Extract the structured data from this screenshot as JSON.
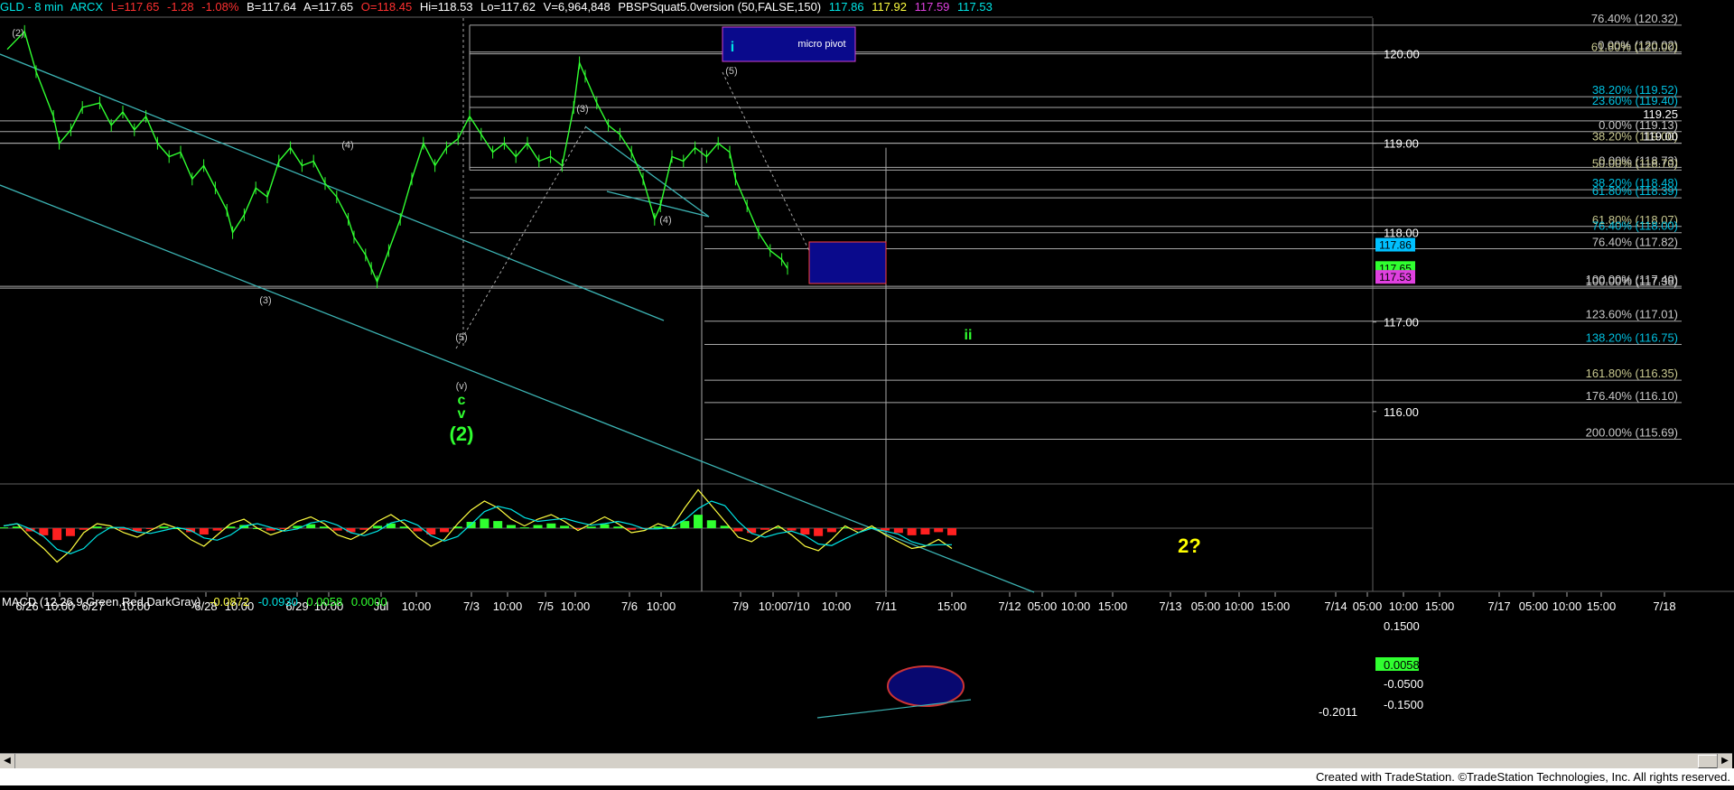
{
  "header": {
    "symbol": "GLD - 8 min",
    "exchange": "ARCX",
    "last": "L=117.65",
    "change": "-1.28",
    "pct": "-1.08%",
    "bid": "B=117.64",
    "ask": "A=117.65",
    "open": "O=118.45",
    "high": "Hi=118.53",
    "low": "Lo=117.62",
    "volume": "V=6,964,848",
    "study": "PBSPSquat5.0version (50,FALSE,150)",
    "v1": "117.86",
    "v2": "117.92",
    "v3": "117.59",
    "v4": "117.53",
    "colors": {
      "cyan": "#00e5e5",
      "yellow": "#ffff40",
      "magenta": "#e040e0",
      "neg": "#ff3030",
      "green": "#30ff30"
    }
  },
  "macd_header": {
    "title": "MACD (12,26,9,Green,Red,DarkGray)",
    "v1": "-0.0872",
    "v2": "-0.0930",
    "v3": "0.0058",
    "v4": "0.0000"
  },
  "footer": {
    "text": "Created with TradeStation. ©TradeStation Technologies, Inc. All rights reserved."
  },
  "chart_data": {
    "type": "candlestick",
    "symbol": "GLD",
    "interval": "8 min",
    "price_axis": {
      "ylim": [
        115.2,
        120.4
      ],
      "ticks": [
        "120.00",
        "119.00",
        "118.00",
        "117.00",
        "116.00"
      ]
    },
    "time_axis": {
      "labels": [
        "6/26",
        "10:00",
        "6/27",
        "10:00",
        "6/28",
        "10:00",
        "6/29",
        "10:00",
        "Jul",
        "10:00",
        "7/3",
        "10:00",
        "7/5",
        "10:00",
        "7/6",
        "10:00",
        "7/9",
        "10:00",
        "7/10",
        "10:00",
        "7/11",
        "15:00",
        "7/12",
        "05:00",
        "10:00",
        "15:00",
        "7/13",
        "05:00",
        "10:00",
        "15:00",
        "7/14",
        "05:00",
        "10:00",
        "15:00",
        "7/17",
        "05:00",
        "10:00",
        "15:00",
        "7/18"
      ]
    },
    "price_path": [
      [
        0,
        120.05
      ],
      [
        6,
        120.25
      ],
      [
        10,
        119.8
      ],
      [
        16,
        119.3
      ],
      [
        18,
        119.0
      ],
      [
        22,
        119.15
      ],
      [
        26,
        119.4
      ],
      [
        32,
        119.45
      ],
      [
        36,
        119.2
      ],
      [
        40,
        119.35
      ],
      [
        44,
        119.15
      ],
      [
        48,
        119.3
      ],
      [
        52,
        119.0
      ],
      [
        56,
        118.85
      ],
      [
        60,
        118.9
      ],
      [
        64,
        118.6
      ],
      [
        68,
        118.75
      ],
      [
        72,
        118.5
      ],
      [
        76,
        118.25
      ],
      [
        78,
        118.0
      ],
      [
        82,
        118.2
      ],
      [
        86,
        118.5
      ],
      [
        90,
        118.4
      ],
      [
        94,
        118.8
      ],
      [
        98,
        118.95
      ],
      [
        102,
        118.75
      ],
      [
        106,
        118.8
      ],
      [
        110,
        118.55
      ],
      [
        114,
        118.4
      ],
      [
        118,
        118.15
      ],
      [
        120,
        117.95
      ],
      [
        124,
        117.75
      ],
      [
        126,
        117.6
      ],
      [
        128,
        117.45
      ],
      [
        132,
        117.8
      ],
      [
        136,
        118.15
      ],
      [
        140,
        118.6
      ],
      [
        144,
        119.0
      ],
      [
        148,
        118.75
      ],
      [
        152,
        118.95
      ],
      [
        156,
        119.05
      ],
      [
        160,
        119.3
      ],
      [
        164,
        119.1
      ],
      [
        168,
        118.9
      ],
      [
        172,
        119.0
      ],
      [
        176,
        118.85
      ],
      [
        180,
        119.0
      ],
      [
        184,
        118.8
      ],
      [
        188,
        118.85
      ],
      [
        192,
        118.75
      ],
      [
        196,
        119.4
      ],
      [
        198,
        119.9
      ],
      [
        200,
        119.75
      ],
      [
        204,
        119.45
      ],
      [
        208,
        119.2
      ],
      [
        212,
        119.1
      ],
      [
        216,
        118.9
      ],
      [
        220,
        118.6
      ],
      [
        224,
        118.15
      ],
      [
        226,
        118.3
      ],
      [
        230,
        118.85
      ],
      [
        234,
        118.8
      ],
      [
        238,
        118.95
      ],
      [
        242,
        118.85
      ],
      [
        246,
        119.0
      ],
      [
        250,
        118.9
      ],
      [
        252,
        118.6
      ],
      [
        256,
        118.3
      ],
      [
        260,
        118.0
      ],
      [
        264,
        117.8
      ],
      [
        268,
        117.7
      ],
      [
        270,
        117.6
      ]
    ],
    "fib_levels": [
      {
        "label": "76.40% (120.32)",
        "price": 120.32,
        "color": "#c8c8c8"
      },
      {
        "label": "0.00% (120.02)",
        "price": 120.02,
        "color": "#c8c8c8"
      },
      {
        "label": "61.80% (120.00)",
        "price": 120.0,
        "color": "#c8c890"
      },
      {
        "label": "38.20% (119.52)",
        "price": 119.52,
        "color": "#00c0e0"
      },
      {
        "label": "23.60% (119.40)",
        "price": 119.4,
        "color": "#00c0e0"
      },
      {
        "label": "119.25",
        "price": 119.25,
        "color": "#ffffff"
      },
      {
        "label": "0.00% (119.13)",
        "price": 119.13,
        "color": "#c8c8c8"
      },
      {
        "label": "38.20% (119.00)",
        "price": 119.0,
        "color": "#c8c890"
      },
      {
        "label": "119.00",
        "price": 119.0,
        "color": "#ffffff"
      },
      {
        "label": "0.00% (118.73)",
        "price": 118.73,
        "color": "#c8c8c8"
      },
      {
        "label": "50.00% (118.70)",
        "price": 118.7,
        "color": "#c8c890"
      },
      {
        "label": "38.20% (118.48)",
        "price": 118.48,
        "color": "#00c0e0"
      },
      {
        "label": "61.80% (118.39)",
        "price": 118.39,
        "color": "#00c0e0"
      },
      {
        "label": "61.80% (118.07)",
        "price": 118.07,
        "color": "#c8c890"
      },
      {
        "label": "76.40% (118.00)",
        "price": 118.0,
        "color": "#00c0e0"
      },
      {
        "label": "76.40% (117.82)",
        "price": 117.82,
        "color": "#c8c8c8"
      },
      {
        "label": "100.00% (117.40)",
        "price": 117.4,
        "color": "#c8c8c8"
      },
      {
        "label": "100.00% (117.38)",
        "price": 117.38,
        "color": "#c8c8c8"
      },
      {
        "label": "123.60% (117.01)",
        "price": 117.01,
        "color": "#c8c8c8"
      },
      {
        "label": "138.20% (116.75)",
        "price": 116.75,
        "color": "#00c0e0"
      },
      {
        "label": "161.80% (116.35)",
        "price": 116.35,
        "color": "#c8c890"
      },
      {
        "label": "176.40% (116.10)",
        "price": 116.1,
        "color": "#c8c8c8"
      },
      {
        "label": "200.00% (115.69)",
        "price": 115.69,
        "color": "#c8c8c8"
      }
    ],
    "price_tags": [
      {
        "text": "117.86",
        "price": 117.86,
        "bg": "#00c0ff"
      },
      {
        "text": "117.65",
        "price": 117.6,
        "bg": "#30ff30"
      },
      {
        "text": "117.53",
        "price": 117.5,
        "bg": "#e040e0"
      }
    ],
    "annotations": [
      {
        "text": "(2)",
        "color": "#c8c8c8",
        "size": "small"
      },
      {
        "text": "(4)",
        "color": "#c8c8c8",
        "size": "small"
      },
      {
        "text": "(3)",
        "color": "#c8c8c8",
        "size": "small"
      },
      {
        "text": "(5)",
        "color": "#c8c8c8",
        "size": "small"
      },
      {
        "text": "(v)",
        "color": "#c8c8c8",
        "size": "small"
      },
      {
        "text": "c",
        "color": "#30ff30",
        "size": "medium"
      },
      {
        "text": "v",
        "color": "#30ff30",
        "size": "medium"
      },
      {
        "text": "(2)",
        "color": "#30ff30",
        "size": "large"
      },
      {
        "text": "(3)",
        "color": "#c8c8c8",
        "size": "small"
      },
      {
        "text": "(4)",
        "color": "#c8c8c8",
        "size": "small"
      },
      {
        "text": "(5)",
        "color": "#c8c8c8",
        "size": "small"
      },
      {
        "text": "i",
        "color": "#00e5e5",
        "size": "medium"
      },
      {
        "text": "ii",
        "color": "#30ff30",
        "size": "medium"
      },
      {
        "text": "2?",
        "color": "#ffff00",
        "size": "large"
      },
      {
        "text": "micro pivot",
        "color": "#ffffff",
        "size": "small"
      }
    ],
    "macd": {
      "label": "MACD (12,26,9,Green,Red,DarkGray)",
      "ylim": [
        -0.2,
        0.2
      ],
      "ticks": [
        "0.1500",
        "0.0058",
        "-0.0500",
        "-0.1500",
        "-0.2011"
      ],
      "values": [
        0.01,
        0.02,
        -0.04,
        -0.09,
        -0.15,
        -0.1,
        -0.02,
        0.02,
        0.01,
        -0.02,
        -0.04,
        -0.01,
        0.02,
        0.0,
        -0.05,
        -0.08,
        -0.03,
        0.02,
        0.04,
        0.0,
        -0.03,
        -0.01,
        0.03,
        0.05,
        0.02,
        -0.03,
        -0.05,
        -0.02,
        0.03,
        0.06,
        0.02,
        -0.04,
        -0.08,
        -0.05,
        0.02,
        0.08,
        0.12,
        0.09,
        0.04,
        0.01,
        0.04,
        0.06,
        0.03,
        -0.01,
        0.02,
        0.05,
        0.02,
        -0.02,
        -0.01,
        0.02,
        0.0,
        0.09,
        0.17,
        0.1,
        0.03,
        -0.04,
        -0.06,
        -0.02,
        0.01,
        -0.03,
        -0.08,
        -0.1,
        -0.05,
        0.01,
        -0.02,
        0.01,
        -0.03,
        -0.06,
        -0.09,
        -0.08,
        -0.05,
        -0.09
      ]
    }
  }
}
